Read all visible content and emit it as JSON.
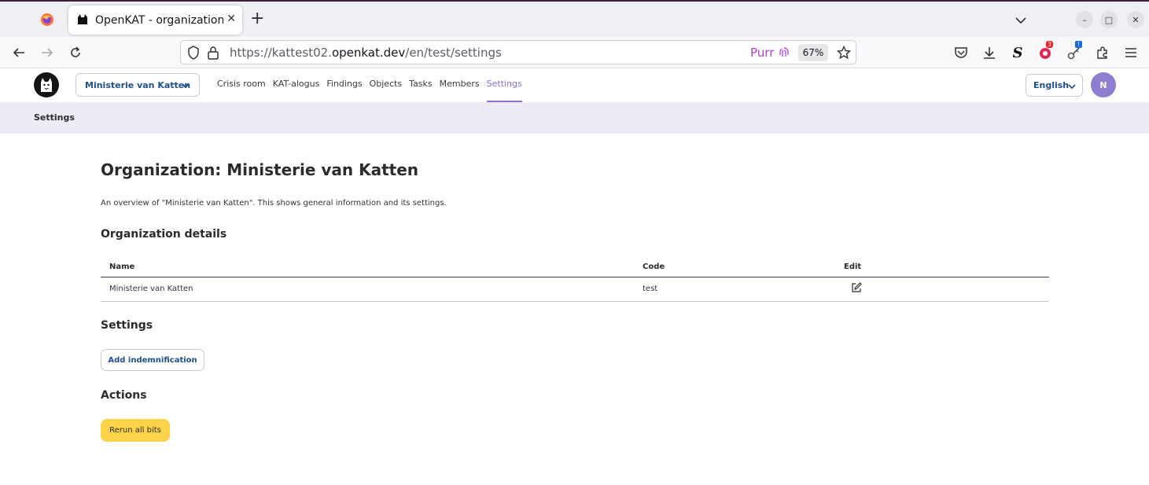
{
  "browser": {
    "tab_title": "OpenKAT - organization_",
    "url_prefix": "https://kattest02.",
    "url_domain": "openkat.dev",
    "url_path": "/en/test/settings",
    "extension_label": "Purr",
    "zoom": "67%",
    "extension_badge_count": "3",
    "extension_badge_alert": "!"
  },
  "header": {
    "org_name": "Ministerie van Katten",
    "nav": [
      "Crisis room",
      "KAT-alogus",
      "Findings",
      "Objects",
      "Tasks",
      "Members",
      "Settings"
    ],
    "active_nav": "Settings",
    "language": "English",
    "avatar_initial": "N"
  },
  "breadcrumb": "Settings",
  "page": {
    "title": "Organization: Ministerie van Katten",
    "intro": "An overview of \"Ministerie van Katten\". This shows general information and its settings.",
    "details_heading": "Organization details",
    "table": {
      "headers": [
        "Name",
        "Code",
        "Edit"
      ],
      "rows": [
        [
          "Ministerie van Katten",
          "test",
          ""
        ]
      ]
    },
    "settings_heading": "Settings",
    "add_indemnification_label": "Add indemnification",
    "actions_heading": "Actions",
    "rerun_label": "Rerun all bits"
  },
  "colors": {
    "accent": "#8b6fd0",
    "breadcrumb_bg": "#eeeaf6",
    "link": "#1e4f8c",
    "action_button": "#fdd34a"
  }
}
